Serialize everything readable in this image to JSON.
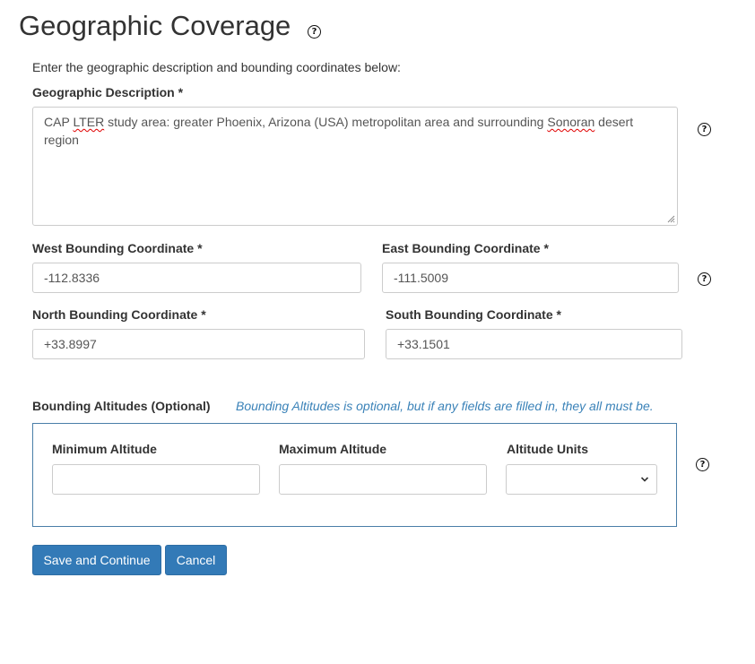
{
  "page": {
    "title": "Geographic Coverage",
    "intro": "Enter the geographic description and bounding coordinates below:"
  },
  "icons": {
    "help": "question-circle-icon",
    "resize": "resize-grip-icon",
    "select_caret": "chevron-down-icon"
  },
  "geo_description": {
    "label": "Geographic Description *",
    "text_parts": [
      "CAP ",
      "LTER",
      " study area: greater Phoenix, Arizona (USA) metropolitan area and surrounding ",
      "Sonoran",
      " desert region"
    ]
  },
  "coordinates": {
    "west": {
      "label": "West Bounding Coordinate *",
      "value": "-112.8336"
    },
    "east": {
      "label": "East Bounding Coordinate *",
      "value": "-111.5009"
    },
    "north": {
      "label": "North Bounding Coordinate *",
      "value": "+33.8997"
    },
    "south": {
      "label": "South Bounding Coordinate *",
      "value": "+33.1501"
    }
  },
  "altitudes": {
    "label": "Bounding Altitudes (Optional)",
    "note": "Bounding Altitudes is optional, but if any fields are filled in, they all must be.",
    "min_label": "Minimum Altitude",
    "max_label": "Maximum Altitude",
    "units_label": "Altitude Units",
    "min_value": "",
    "max_value": "",
    "units_value": ""
  },
  "buttons": {
    "save": "Save and Continue",
    "cancel": "Cancel"
  },
  "colors": {
    "primary": "#337ab7",
    "note": "#3a82b8",
    "fieldset_border": "#4a7ea8"
  }
}
